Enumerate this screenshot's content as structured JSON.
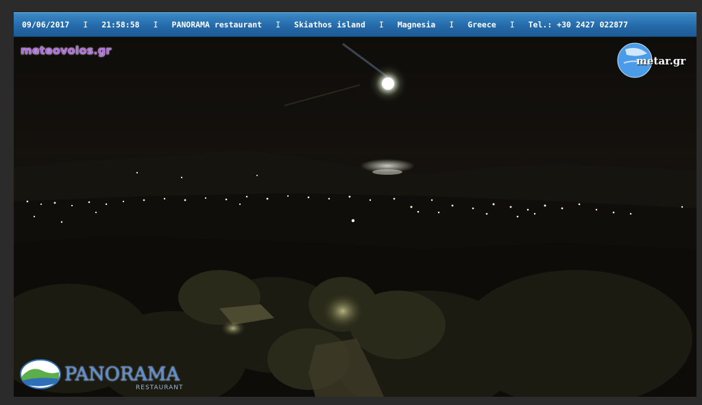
{
  "banner": {
    "date": "09/06/2017",
    "time": "21:58:58",
    "venue": "PANORAMA restaurant",
    "place": "Skiathos island",
    "region": "Magnesia",
    "country": "Greece",
    "phone": "Tel.: +30 2427 022877",
    "separator": "I"
  },
  "logos": {
    "meteo": "meteovolos.gr",
    "metar": "metar.gr",
    "panorama_name": "PANORAMA",
    "panorama_sub": "RESTAURANT"
  },
  "colors": {
    "banner_blue": "#2368a8",
    "meteo_purple": "#b06ae0",
    "panorama_blue": "#5a8fd6",
    "night_sky": "#0b0a08"
  }
}
